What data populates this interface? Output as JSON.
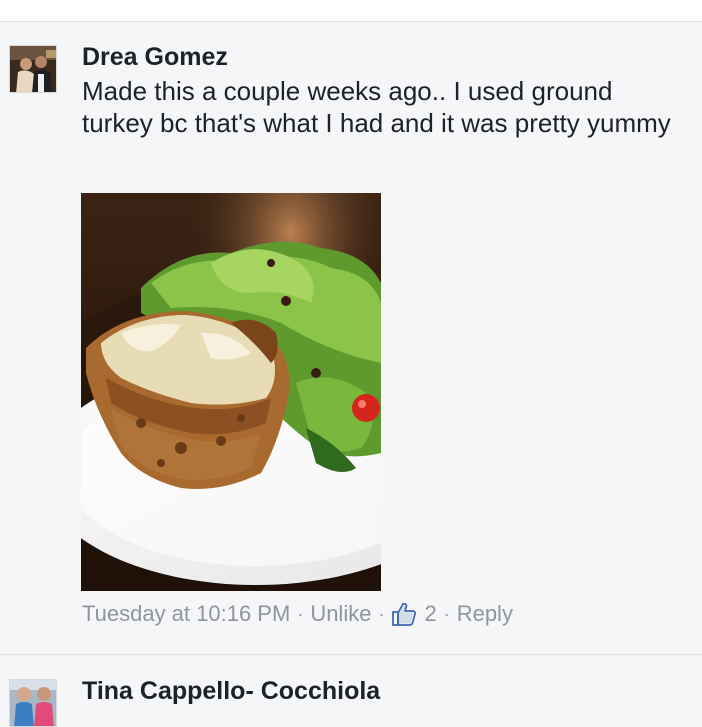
{
  "comments": [
    {
      "author": "Drea Gomez",
      "text": "Made this a couple weeks ago.. I used ground turkey bc that's what I had and it was pretty yummy",
      "timestamp": "Tuesday at 10:16 PM",
      "unlike_label": "Unlike",
      "like_count": "2",
      "reply_label": "Reply",
      "separator": "·"
    },
    {
      "author": "Tina Cappello- Cocchiola"
    }
  ],
  "colors": {
    "text": "#1d2129",
    "meta": "#90949c",
    "like_blue": "#4267b2",
    "background": "#f5f6f7"
  },
  "icons": {
    "like": "thumbs-up-icon"
  }
}
